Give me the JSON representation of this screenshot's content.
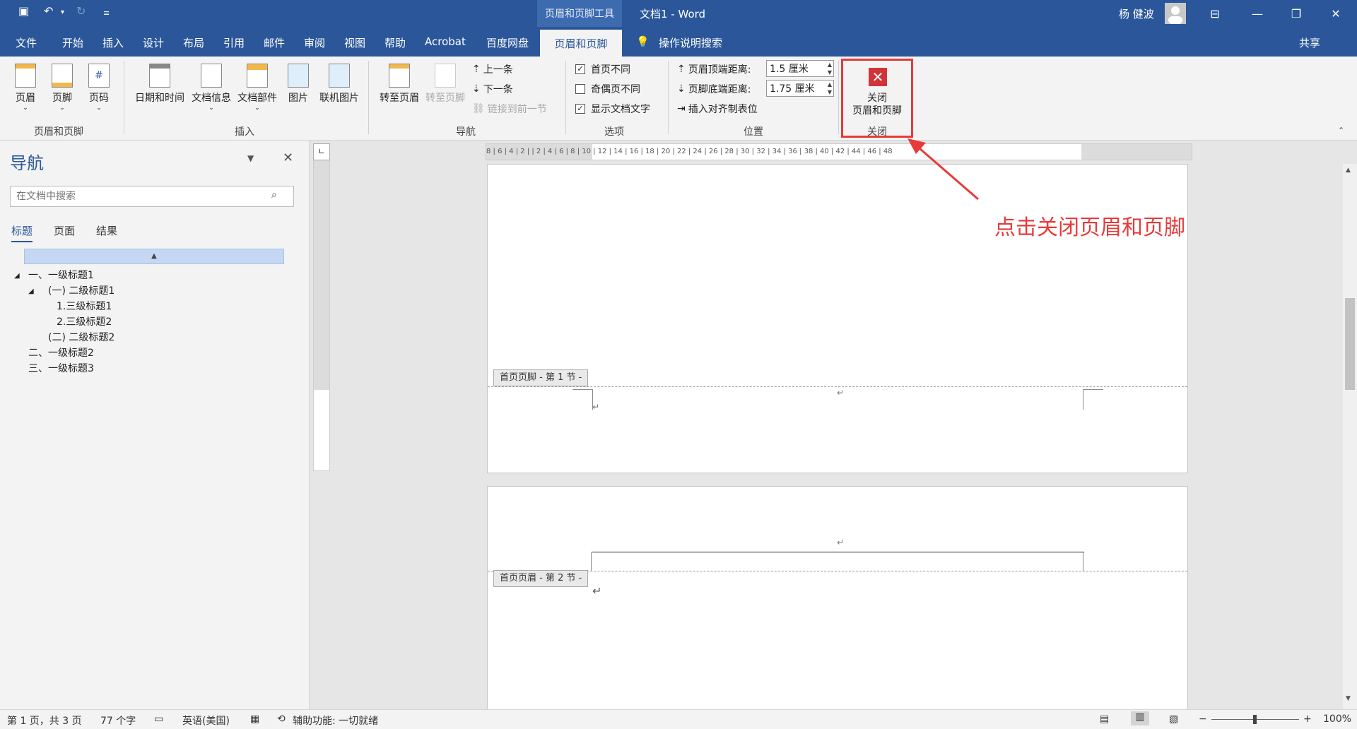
{
  "titlebar": {
    "context_tools": "页眉和页脚工具",
    "doc_title": "文档1 - Word",
    "user_name": "杨 健波"
  },
  "tabs": [
    "文件",
    "开始",
    "插入",
    "设计",
    "布局",
    "引用",
    "邮件",
    "审阅",
    "视图",
    "帮助",
    "Acrobat",
    "百度网盘"
  ],
  "active_tab": "页眉和页脚",
  "tell_me": "操作说明搜索",
  "share": "共享",
  "ribbon": {
    "group_header_footer": {
      "label": "页眉和页脚",
      "header": "页眉",
      "footer": "页脚",
      "page_number": "页码"
    },
    "group_insert": {
      "label": "插入",
      "date_time": "日期和时间",
      "doc_info": "文档信息",
      "doc_parts": "文档部件",
      "picture": "图片",
      "online_picture": "联机图片"
    },
    "group_nav": {
      "label": "导航",
      "goto_header": "转至页眉",
      "goto_footer": "转至页脚",
      "prev": "上一条",
      "next": "下一条",
      "link_prev": "链接到前一节"
    },
    "group_options": {
      "label": "选项",
      "diff_first": "首页不同",
      "diff_odd_even": "奇偶页不同",
      "show_text": "显示文档文字"
    },
    "group_position": {
      "label": "位置",
      "header_top_label": "页眉顶端距离:",
      "header_top_value": "1.5 厘米",
      "footer_bottom_label": "页脚底端距离:",
      "footer_bottom_value": "1.75 厘米",
      "insert_align_tab": "插入对齐制表位"
    },
    "group_close": {
      "label": "关闭",
      "close_line1": "关闭",
      "close_line2": "页眉和页脚"
    }
  },
  "nav": {
    "title": "导航",
    "search_placeholder": "在文档中搜索",
    "tabs": [
      "标题",
      "页面",
      "结果"
    ],
    "headings": [
      "一、一级标题1",
      "(一) 二级标题1",
      "1.三级标题1",
      "2.三级标题2",
      "(二) 二级标题2",
      "二、一级标题2",
      "三、一级标题3"
    ]
  },
  "ruler": {
    "h_ticks": "8 | 6 | 4 | 2 | | 2 | 4 | 6 | 8 | 10 | 12 | 14 | 16 | 18 | 20 | 22 | 24 | 26 | 28 | 30 | 32 | 34 | 36 | 38 | 40 | 42 | 44 | 46 | 48"
  },
  "page": {
    "footer_label_1": "首页页脚 - 第 1 节 -",
    "header_label_2": "首页页眉 - 第 2 节 -"
  },
  "annotation": "点击关闭页眉和页脚",
  "status": {
    "page_info": "第 1 页，共 3 页",
    "word_count": "77 个字",
    "language": "英语(美国)",
    "accessibility": "辅助功能: 一切就绪",
    "zoom": "100%"
  },
  "colors": {
    "brand_blue": "#2b579a",
    "annotation_red": "#e83a3a"
  }
}
